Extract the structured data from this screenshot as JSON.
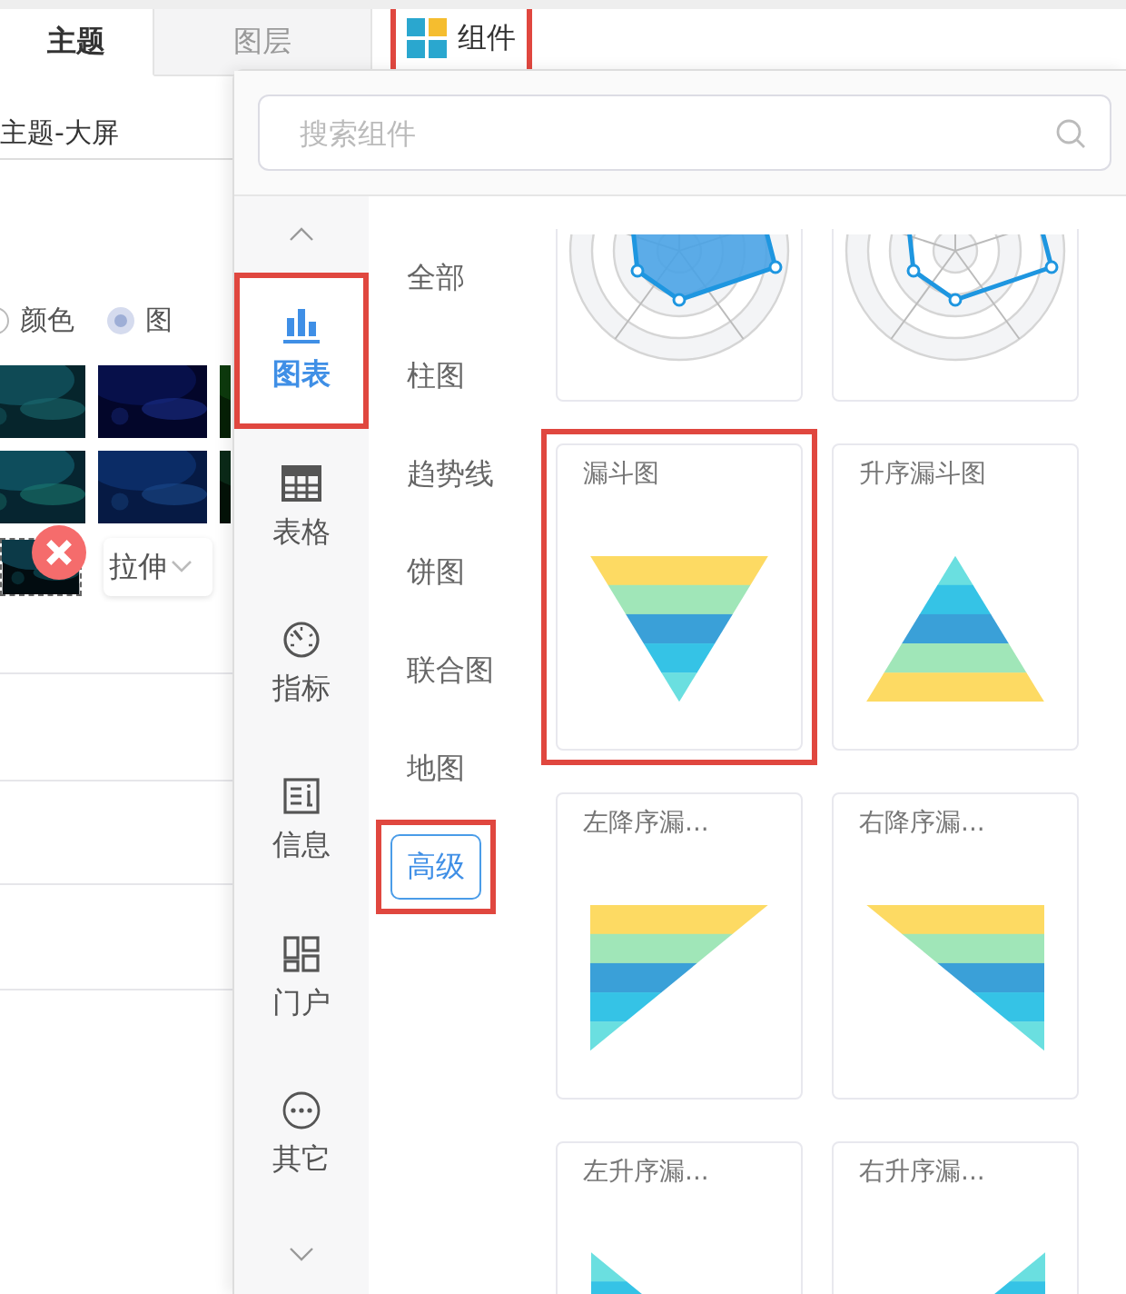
{
  "tabs": [
    {
      "label": "主题",
      "selected": true
    },
    {
      "label": "图层",
      "selected": false
    }
  ],
  "component_button": {
    "label": "组件",
    "highlighted": true
  },
  "theme_name": {
    "value": "主题-大屏"
  },
  "background_type": [
    {
      "label": "颜色",
      "selected": false
    },
    {
      "label": "图",
      "selected": true
    }
  ],
  "backgrounds": [
    {
      "kind": "picture"
    },
    {
      "kind": "picture"
    },
    {
      "kind": "picture"
    },
    {
      "kind": "picture"
    },
    {
      "kind": "picture"
    },
    {
      "kind": "picture"
    }
  ],
  "custom_background": {
    "kind": "picture",
    "removable": true
  },
  "fit_mode": {
    "value": "拉伸"
  },
  "search": {
    "placeholder": "搜索组件"
  },
  "categories": [
    {
      "label": "图表",
      "kind": "chart",
      "selected": true,
      "highlighted": true
    },
    {
      "label": "表格",
      "kind": "table",
      "selected": false,
      "highlighted": false
    },
    {
      "label": "指标",
      "kind": "gauge",
      "selected": false,
      "highlighted": false
    },
    {
      "label": "信息",
      "kind": "info",
      "selected": false,
      "highlighted": false
    },
    {
      "label": "门户",
      "kind": "portal",
      "selected": false,
      "highlighted": false
    },
    {
      "label": "其它",
      "kind": "more",
      "selected": false,
      "highlighted": false
    }
  ],
  "subcategories": [
    {
      "label": "全部",
      "selected": false,
      "highlighted": false
    },
    {
      "label": "柱图",
      "selected": false,
      "highlighted": false
    },
    {
      "label": "趋势线",
      "selected": false,
      "highlighted": false
    },
    {
      "label": "饼图",
      "selected": false,
      "highlighted": false
    },
    {
      "label": "联合图",
      "selected": false,
      "highlighted": false
    },
    {
      "label": "地图",
      "selected": false,
      "highlighted": false
    },
    {
      "label": "高级",
      "selected": true,
      "highlighted": true
    }
  ],
  "components": [
    {
      "kind": "radar-filled",
      "highlighted": false
    },
    {
      "kind": "radar-line",
      "highlighted": false
    },
    {
      "title": "漏斗图",
      "kind": "funnel-down",
      "highlighted": true
    },
    {
      "title": "升序漏斗图",
      "kind": "funnel-up",
      "highlighted": false
    },
    {
      "title": "左降序漏...",
      "kind": "left-desc",
      "highlighted": false
    },
    {
      "title": "右降序漏...",
      "kind": "right-desc",
      "highlighted": false
    },
    {
      "title": "左升序漏...",
      "kind": "left-asc",
      "highlighted": false
    },
    {
      "title": "右升序漏...",
      "kind": "right-asc",
      "highlighted": false
    }
  ]
}
